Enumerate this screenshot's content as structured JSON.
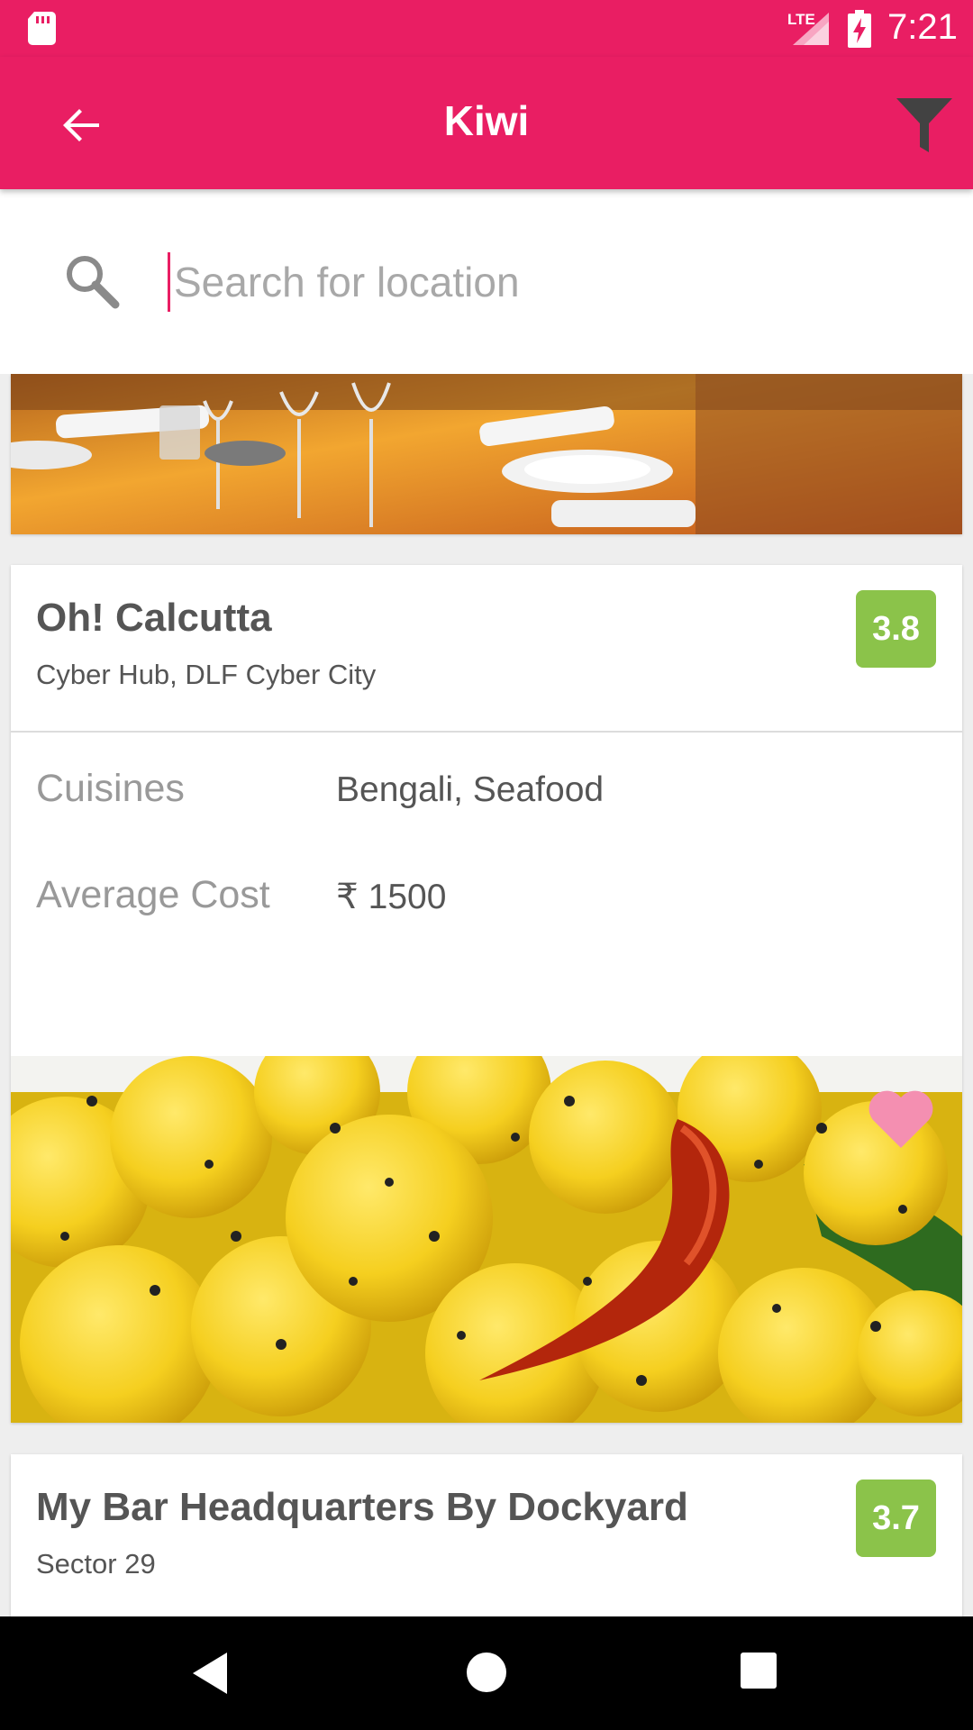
{
  "status_bar": {
    "network_label": "LTE",
    "time": "7:21"
  },
  "toolbar": {
    "title": "Kiwi",
    "back_icon": "arrow-left-icon",
    "filter_icon": "filter-icon",
    "color": "#e91e63"
  },
  "search": {
    "value": "",
    "placeholder": "Search for location",
    "locate_icon": "send-location-icon",
    "locate_color": "#fbc02d"
  },
  "restaurants": [
    {
      "name": "Oh! Calcutta",
      "location": "Cyber Hub, DLF Cyber City",
      "rating": "3.8",
      "cuisines_label": "Cuisines",
      "cuisines": "Bengali, Seafood",
      "cost_label": "Average Cost",
      "cost": "₹ 1500",
      "favorite": true
    },
    {
      "name": "My Bar Headquarters By Dockyard",
      "location": "Sector 29",
      "rating": "3.7"
    }
  ],
  "colors": {
    "rating_green": "#8bc34a",
    "favorite_pink": "#f48fb1"
  }
}
